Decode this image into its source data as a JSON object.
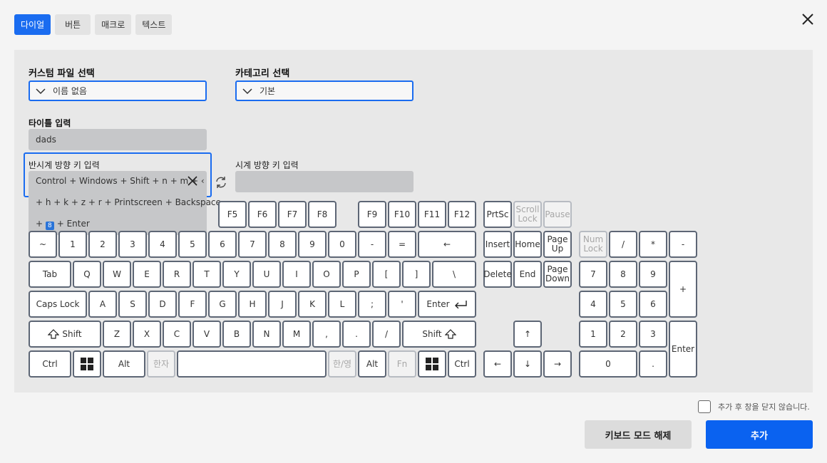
{
  "tabs": [
    "다이얼",
    "버튼",
    "매크로",
    "텍스트"
  ],
  "form": {
    "custom_file_label": "커스텀 파일 선택",
    "custom_file_value": "이름 없음",
    "category_label": "카테고리 선택",
    "category_value": "기본",
    "title_label": "타이틀 입력",
    "title_value": "dads",
    "ccw_label": "반시계 방향 키 입력",
    "cw_label": "시계 방향 키 입력",
    "cw_value": "",
    "ccw_lines": [
      "Control + Windows + Shift + n + m + ‹",
      "+ h + k + z + r + Printscreen + Backspace",
      "+",
      "+ Enter"
    ],
    "ccw_inline_key": "8"
  },
  "keys": {
    "f5": "F5",
    "f6": "F6",
    "f7": "F7",
    "f8": "F8",
    "f9": "F9",
    "f10": "F10",
    "f11": "F11",
    "f12": "F12",
    "prtsc": "PrtSc",
    "scroll_lock": "Scroll Lock",
    "pause": "Pause",
    "tilde": "~",
    "n1": "1",
    "n2": "2",
    "n3": "3",
    "n4": "4",
    "n5": "5",
    "n6": "6",
    "n7": "7",
    "n8": "8",
    "n9": "9",
    "n0": "0",
    "minus": "-",
    "equal": "=",
    "backspace": "←",
    "insert": "Insert",
    "home": "Home",
    "page_up": "Page Up",
    "num_lock": "Num Lock",
    "np_div": "/",
    "np_mul": "*",
    "np_sub": "-",
    "tab": "Tab",
    "q": "Q",
    "w": "W",
    "e": "E",
    "r": "R",
    "t": "T",
    "y": "Y",
    "u": "U",
    "i": "I",
    "o": "O",
    "p": "P",
    "lbracket": "[",
    "rbracket": "]",
    "backslash": "\\",
    "delete": "Delete",
    "end": "End",
    "page_down": "Page Down",
    "np7": "7",
    "np8": "8",
    "np9": "9",
    "np_add": "+",
    "caps": "Caps Lock",
    "a": "A",
    "s": "S",
    "d": "D",
    "f": "F",
    "g": "G",
    "h": "H",
    "j": "J",
    "k": "K",
    "l": "L",
    "semicolon": ";",
    "quote": "'",
    "enter": "Enter",
    "np4": "4",
    "np5": "5",
    "np6": "6",
    "lshift": "Shift",
    "z": "Z",
    "x": "X",
    "c": "C",
    "v": "V",
    "b": "B",
    "n": "N",
    "m": "M",
    "comma": ",",
    "period": ".",
    "slash": "/",
    "rshift": "Shift",
    "up": "↑",
    "np1": "1",
    "np2": "2",
    "np3": "3",
    "np_enter": "Enter",
    "lctrl": "Ctrl",
    "lalt": "Alt",
    "hanja": "한자",
    "hanyeong": "한/영",
    "ralt": "Alt",
    "fn": "Fn",
    "rctrl": "Ctrl",
    "left": "←",
    "down": "↓",
    "right": "→",
    "np0": "0",
    "np_dot": "."
  },
  "icons": [
    "close-icon",
    "chevron-down-icon",
    "clear-icon",
    "refresh-icon",
    "windows-icon",
    "shift-arrow-icon",
    "enter-arrow-icon"
  ],
  "footer": {
    "no_close_text": "추가 후 창을 닫지 않습니다.",
    "no_close_checked": false,
    "release_keyboard_mode": "키보드 모드 해제",
    "add_button": "추가"
  },
  "colors": {
    "accent": "#1a6cf0",
    "primary_button": "#0a62f0",
    "key_border": "#5d6675"
  }
}
